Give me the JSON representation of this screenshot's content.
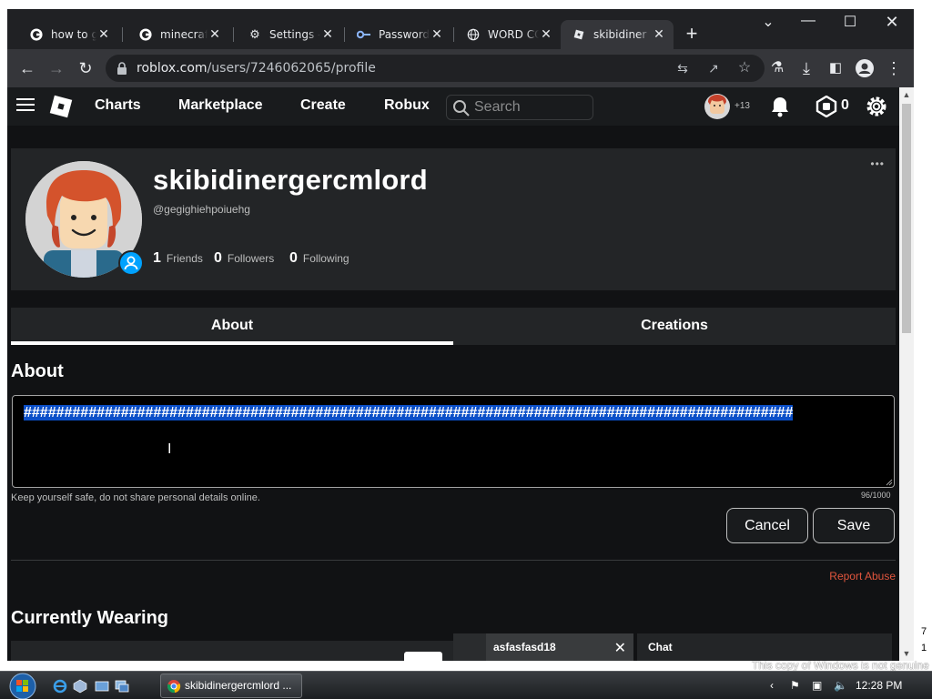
{
  "browser": {
    "tabs": [
      {
        "title": "how to get",
        "icon": "google-icon"
      },
      {
        "title": "minecraft",
        "icon": "google-icon"
      },
      {
        "title": "Settings –",
        "icon": "gear-icon"
      },
      {
        "title": "Password",
        "icon": "key-icon"
      },
      {
        "title": "WORD CO",
        "icon": "globe-icon"
      },
      {
        "title": "skibidiner",
        "icon": "roblox-icon"
      }
    ],
    "url_host": "roblox.com",
    "url_path": "/users/7246062065/profile"
  },
  "header": {
    "nav": [
      "Charts",
      "Marketplace",
      "Create",
      "Robux"
    ],
    "search_placeholder": "Search",
    "friend_badge": "+13",
    "robux_count": "0"
  },
  "profile": {
    "display_name": "skibidinergercmlord",
    "username": "@gegighiehpoiuehg",
    "friends": {
      "count": "1",
      "label": "Friends"
    },
    "followers": {
      "count": "0",
      "label": "Followers"
    },
    "following": {
      "count": "0",
      "label": "Following"
    },
    "menu": "•••"
  },
  "tabs": {
    "about": "About",
    "creations": "Creations"
  },
  "about": {
    "heading": "About",
    "text": "###############################################################################################",
    "counter": "96/1000",
    "safety_note": "Keep yourself safe, do not share personal details online.",
    "cancel": "Cancel",
    "save": "Save",
    "report": "Report Abuse"
  },
  "wearing": {
    "heading": "Currently Wearing"
  },
  "chat": {
    "conversation": "asfasfasd18",
    "title": "Chat"
  },
  "taskbar": {
    "task_label": "skibidinergercmlord ...",
    "time": "12:28 PM",
    "watermark": "This copy of Windows is not genuine",
    "build_line1": "7",
    "build_line2": "1"
  },
  "colors": {
    "accent": "#0b4fc8",
    "report": "#e1553d",
    "page_bg": "#111214"
  }
}
